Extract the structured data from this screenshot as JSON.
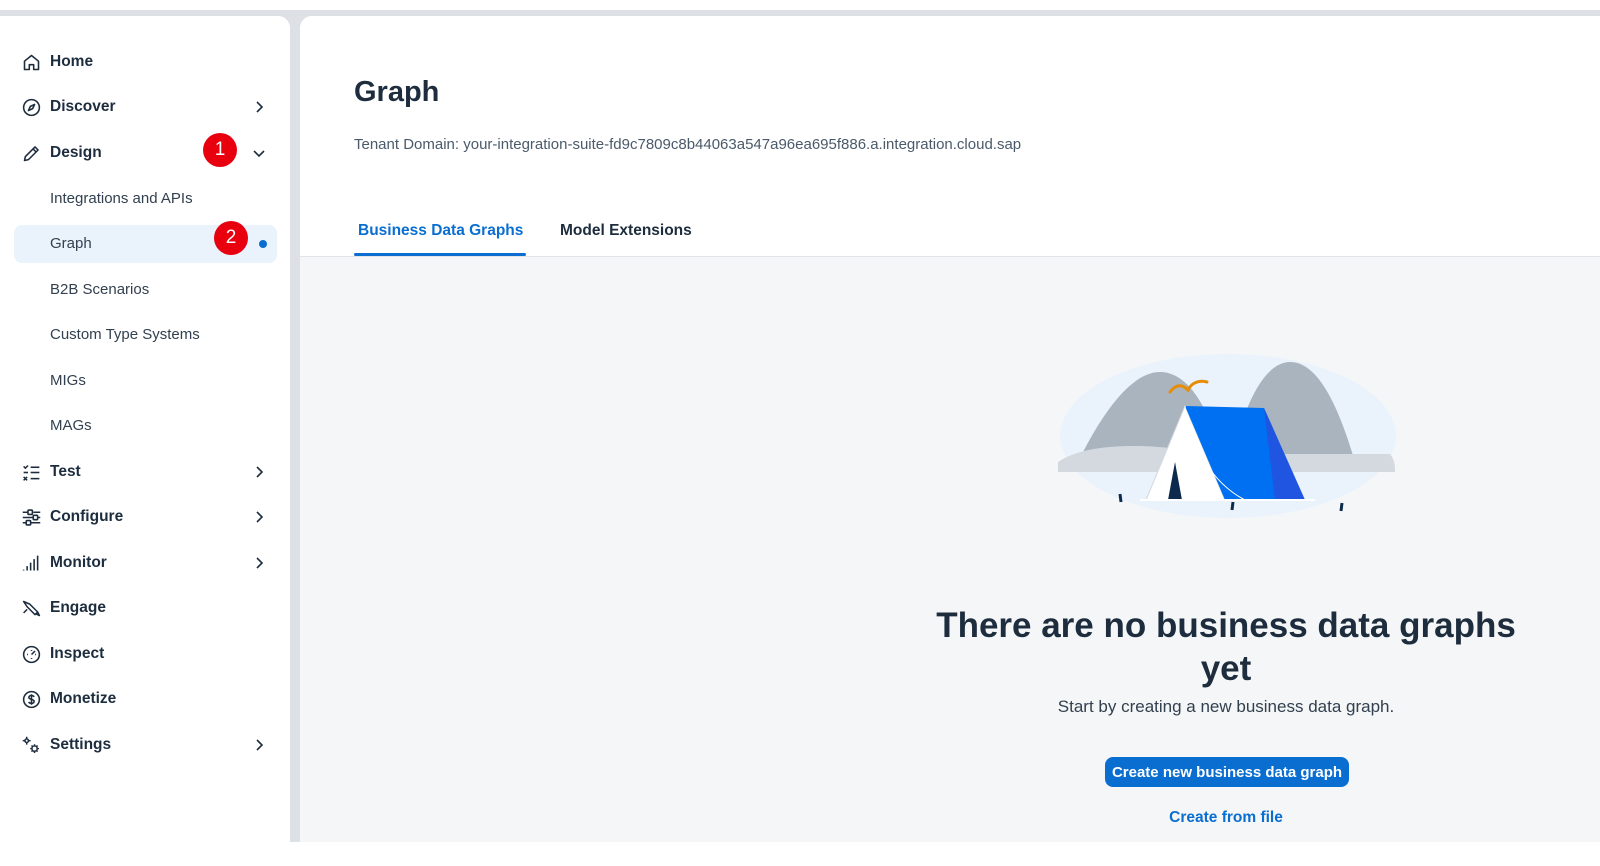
{
  "sidebar": {
    "items": [
      {
        "label": "Home",
        "icon": "home-icon"
      },
      {
        "label": "Discover",
        "icon": "compass-icon"
      },
      {
        "label": "Design",
        "icon": "pencil-icon"
      },
      {
        "label": "Test",
        "icon": "checklist-icon"
      },
      {
        "label": "Configure",
        "icon": "sliders-icon"
      },
      {
        "label": "Monitor",
        "icon": "bars-icon"
      },
      {
        "label": "Engage",
        "icon": "engage-icon"
      },
      {
        "label": "Inspect",
        "icon": "inspect-icon"
      },
      {
        "label": "Monetize",
        "icon": "dollar-icon"
      },
      {
        "label": "Settings",
        "icon": "gears-icon"
      }
    ],
    "design_subitems": [
      {
        "label": "Integrations and APIs"
      },
      {
        "label": "Graph"
      },
      {
        "label": "B2B Scenarios"
      },
      {
        "label": "Custom Type Systems"
      },
      {
        "label": "MIGs"
      },
      {
        "label": "MAGs"
      }
    ],
    "badges": [
      "1",
      "2"
    ]
  },
  "main": {
    "title": "Graph",
    "tenant_domain": "Tenant Domain: your-integration-suite-fd9c7809c8b44063a547a96ea695f886.a.integration.cloud.sap",
    "tabs": [
      {
        "label": "Business Data Graphs"
      },
      {
        "label": "Model Extensions"
      }
    ],
    "empty_state": {
      "title": "There are no business data graphs yet",
      "subtitle": "Start by creating a new business data graph.",
      "primary_button": "Create new business data graph",
      "link": "Create from file"
    }
  },
  "colors": {
    "accent": "#0a6ed1",
    "badge": "#e8000e",
    "text": "#1d2d3e",
    "selected_bg": "#eaf2fc"
  }
}
